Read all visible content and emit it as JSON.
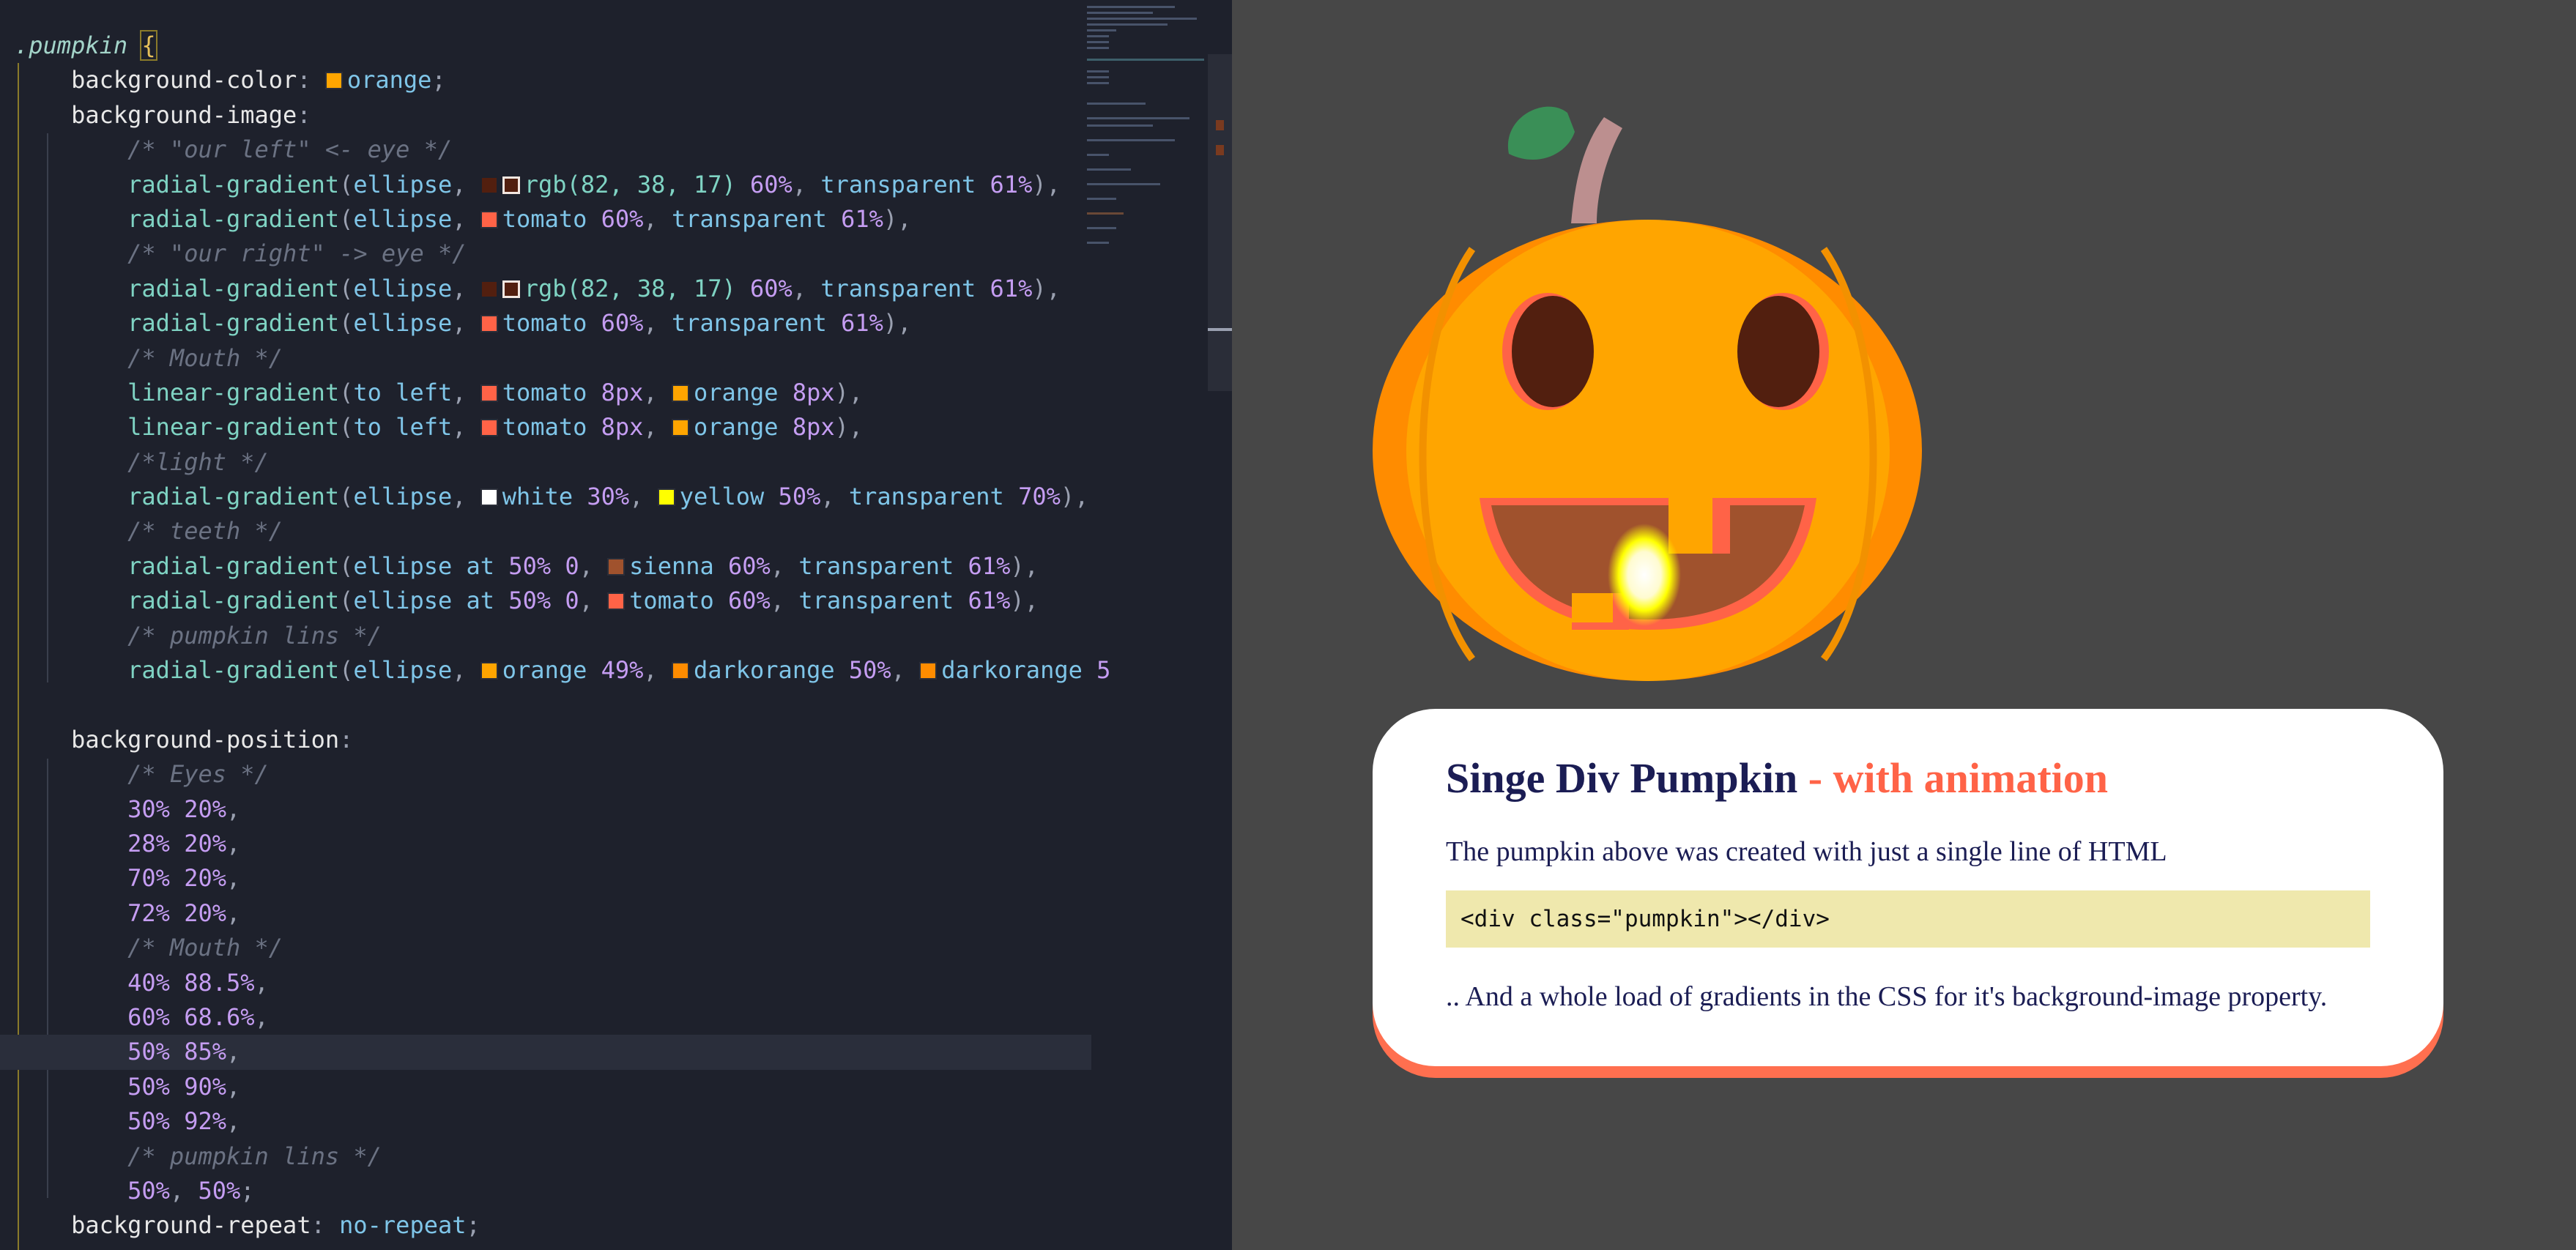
{
  "colors": {
    "editor_bg": "#1e212c",
    "preview_bg": "#474747",
    "accent": "#ff6347",
    "title": "#1b1d54",
    "code_bg": "#efe8ad"
  },
  "code": {
    "selector": ".pumpkin",
    "open_brace": "{",
    "p_bgcolor": "background-color",
    "v_orange": "orange",
    "p_bgimage": "background-image",
    "c_left_eye": "/* \"our left\" <- eye */",
    "c_right_eye": "/* \"our right\" -> eye */",
    "c_mouth": "/* Mouth */",
    "c_light": "/*light */",
    "c_teeth": "/* teeth */",
    "c_lins": "/* pumpkin lins */",
    "c_eyes": "/* Eyes */",
    "c_mouth2": "/* Mouth */",
    "c_lins2": "/* pumpkin lins */",
    "fn_radial": "radial-gradient",
    "fn_linear": "linear-gradient",
    "kw_ellipse": "ellipse",
    "kw_ellipse_at": "ellipse at",
    "kw_to_left": "to left",
    "v_rgb": "rgb(82, 38, 17)",
    "v_tomato": "tomato",
    "v_transparent": "transparent",
    "v_white": "white",
    "v_yellow": "yellow",
    "v_sienna": "sienna",
    "v_darkorange": "darkorange",
    "n60": "60%",
    "n61": "61%",
    "n8px": "8px",
    "n30": "30%",
    "n50": "50%",
    "n70": "70%",
    "n50_0": "50% 0",
    "n49": "49%",
    "n5": "5",
    "p_bgpos": "background-position",
    "pos": [
      "30% 20%",
      "28% 20%",
      "70% 20%",
      "72% 20%",
      "40% 88.5%",
      "60% 68.6%",
      "50% 85%",
      "50% 90%",
      "50% 92%"
    ],
    "pos_last_a": "50%",
    "pos_last_b": "50%",
    "p_bgrepeat": "background-repeat",
    "v_norepeat": "no-repeat"
  },
  "card": {
    "title_main": "Singe Div Pumpkin",
    "title_accent": " - with animation",
    "intro": "The pumpkin above was created with just a single line of HTML",
    "snippet": "<div class=\"pumpkin\"></div>",
    "outro": ".. And a whole load of gradients in the CSS for it's background-image property."
  }
}
